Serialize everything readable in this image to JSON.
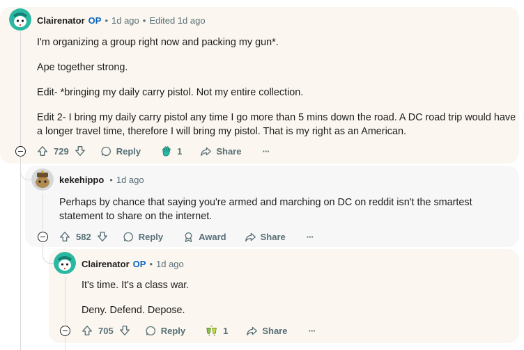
{
  "comments": [
    {
      "author": "Clairenator",
      "op_badge": "OP",
      "time": "1d ago",
      "edited": "Edited 1d ago",
      "paragraphs": [
        "I'm organizing a group right now and packing my gun*.",
        "Ape together strong.",
        "Edit- *bringing my daily carry pistol. Not my entire collection.",
        "Edit 2- I bring my daily carry pistol any time I go more than 5 mins down the road. A DC road trip would have a longer travel time, therefore I will bring my pistol. That is my right as an American."
      ],
      "votes": "729",
      "reply_label": "Reply",
      "award_count": "1",
      "share_label": "Share",
      "more_label": "···"
    },
    {
      "author": "kekehippo",
      "time": "1d ago",
      "paragraphs": [
        "Perhaps by chance that saying you're armed and marching on DC on reddit isn't the smartest statement to share on the internet."
      ],
      "votes": "582",
      "reply_label": "Reply",
      "award_label": "Award",
      "share_label": "Share",
      "more_label": "···"
    },
    {
      "author": "Clairenator",
      "op_badge": "OP",
      "time": "1d ago",
      "paragraphs": [
        "It's time. It's a class war.",
        "Deny. Defend. Depose."
      ],
      "votes": "705",
      "reply_label": "Reply",
      "award_count": "1",
      "share_label": "Share",
      "more_label": "···"
    }
  ],
  "colors": {
    "op_blue": "#0a66c2",
    "muted_text": "#576f76",
    "thread_line": "#d9dadc",
    "highlight_bg": "#fbf6ef",
    "reply_bg": "#f7f7f8"
  }
}
